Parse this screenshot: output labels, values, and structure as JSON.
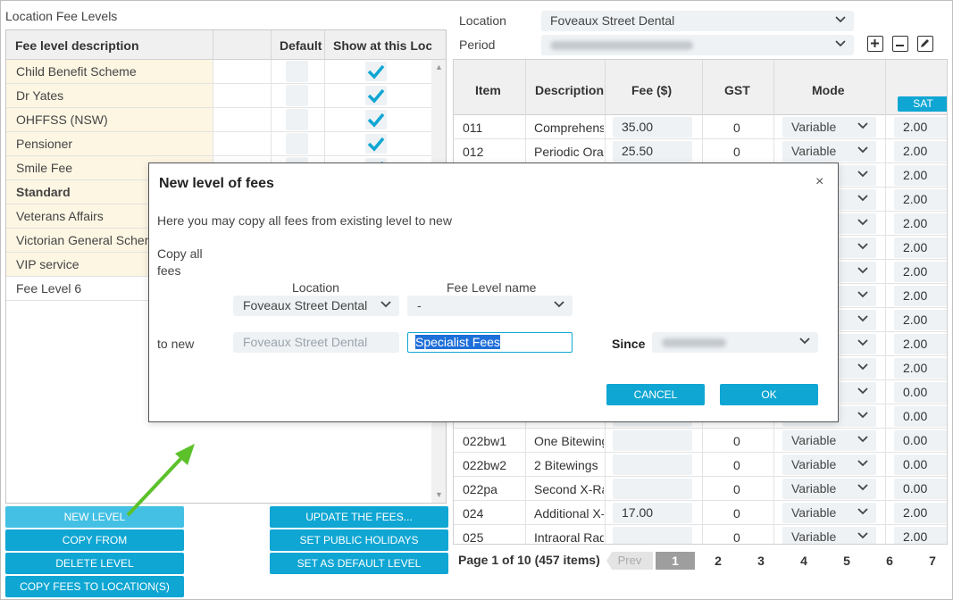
{
  "left_panel": {
    "title": "Location Fee Levels",
    "columns": [
      "Fee level description",
      "Default",
      "Show at this Location"
    ],
    "rows": [
      {
        "name": "Child Benefit Scheme",
        "shown": true
      },
      {
        "name": "Dr Yates",
        "shown": true
      },
      {
        "name": "OHFFSS (NSW)",
        "shown": true
      },
      {
        "name": "Pensioner",
        "shown": true
      },
      {
        "name": "Smile Fee",
        "shown": true
      },
      {
        "name": "Standard",
        "shown": true
      },
      {
        "name": "Veterans Affairs",
        "shown": true
      },
      {
        "name": "Victorian General Scheme",
        "shown": true
      },
      {
        "name": "VIP service",
        "shown": true
      },
      {
        "name": "Fee Level 6",
        "shown": false
      }
    ],
    "buttons": {
      "new_level": "NEW LEVEL",
      "copy_from": "COPY FROM",
      "delete_level": "DELETE LEVEL",
      "copy_fees_to_location": "COPY FEES TO LOCATION(S)",
      "update_fees": "UPDATE THE FEES...",
      "set_public_holidays": "SET PUBLIC HOLIDAYS",
      "set_default_level": "SET AS DEFAULT LEVEL"
    }
  },
  "right_panel": {
    "location_label": "Location",
    "location_value": "Foveaux Street Dental",
    "period_label": "Period",
    "columns": [
      "Item",
      "Description",
      "Fee ($)",
      "GST",
      "Mode",
      "SAT"
    ],
    "rows": [
      {
        "item": "011",
        "desc": "Comprehensive",
        "fee": "35.00",
        "gst": "0",
        "mode": "Variable",
        "sat": "2.00"
      },
      {
        "item": "012",
        "desc": "Periodic Oral",
        "fee": "25.50",
        "gst": "0",
        "mode": "Variable",
        "sat": "2.00"
      },
      {
        "item": "",
        "desc": "",
        "fee": "",
        "gst": "",
        "mode": "",
        "sat": "2.00"
      },
      {
        "item": "",
        "desc": "",
        "fee": "",
        "gst": "",
        "mode": "",
        "sat": "2.00"
      },
      {
        "item": "",
        "desc": "",
        "fee": "",
        "gst": "",
        "mode": "",
        "sat": "2.00"
      },
      {
        "item": "",
        "desc": "",
        "fee": "",
        "gst": "",
        "mode": "",
        "sat": "2.00"
      },
      {
        "item": "",
        "desc": "",
        "fee": "",
        "gst": "",
        "mode": "",
        "sat": "2.00"
      },
      {
        "item": "",
        "desc": "",
        "fee": "",
        "gst": "",
        "mode": "",
        "sat": "2.00"
      },
      {
        "item": "",
        "desc": "",
        "fee": "",
        "gst": "",
        "mode": "",
        "sat": "2.00"
      },
      {
        "item": "",
        "desc": "",
        "fee": "",
        "gst": "",
        "mode": "",
        "sat": "2.00"
      },
      {
        "item": "",
        "desc": "",
        "fee": "",
        "gst": "",
        "mode": "",
        "sat": "2.00"
      },
      {
        "item": "",
        "desc": "",
        "fee": "",
        "gst": "",
        "mode": "",
        "sat": "0.00"
      },
      {
        "item": "",
        "desc": "",
        "fee": "",
        "gst": "",
        "mode": "",
        "sat": "0.00"
      },
      {
        "item": "022bw1",
        "desc": "One Bitewing",
        "fee": "",
        "gst": "0",
        "mode": "Variable",
        "sat": "0.00"
      },
      {
        "item": "022bw2",
        "desc": "2 Bitewings",
        "fee": "",
        "gst": "0",
        "mode": "Variable",
        "sat": "0.00"
      },
      {
        "item": "022pa",
        "desc": "Second X-Ray",
        "fee": "",
        "gst": "0",
        "mode": "Variable",
        "sat": "0.00"
      },
      {
        "item": "024",
        "desc": "Additional X-Ray",
        "fee": "17.00",
        "gst": "0",
        "mode": "Variable",
        "sat": "2.00"
      },
      {
        "item": "025",
        "desc": "Intraoral Radiograph",
        "fee": "",
        "gst": "0",
        "mode": "Variable",
        "sat": "2.00"
      }
    ],
    "pager": {
      "info": "Page 1 of 10 (457 items)",
      "prev": "Prev",
      "pages": [
        "1",
        "2",
        "3",
        "4",
        "5",
        "6",
        "7"
      ]
    }
  },
  "modal": {
    "title": "New level of fees",
    "close": "×",
    "description": "Here you may copy all fees from existing level to new",
    "copy_all_label": "Copy all fees",
    "location_header": "Location",
    "fee_level_header": "Fee Level name",
    "source_location": "Foveaux Street Dental",
    "source_fee_level": "-",
    "to_new_label": "to new",
    "target_location": "Foveaux Street Dental",
    "new_level_name": "Specialist Fees",
    "since_label": "Since",
    "cancel": "CANCEL",
    "ok": "OK"
  },
  "colors": {
    "accent": "#0fa6d3",
    "row_highlight": "#fdf6e3",
    "field_bg": "#eef2f5",
    "arrow": "#5cc12a"
  }
}
